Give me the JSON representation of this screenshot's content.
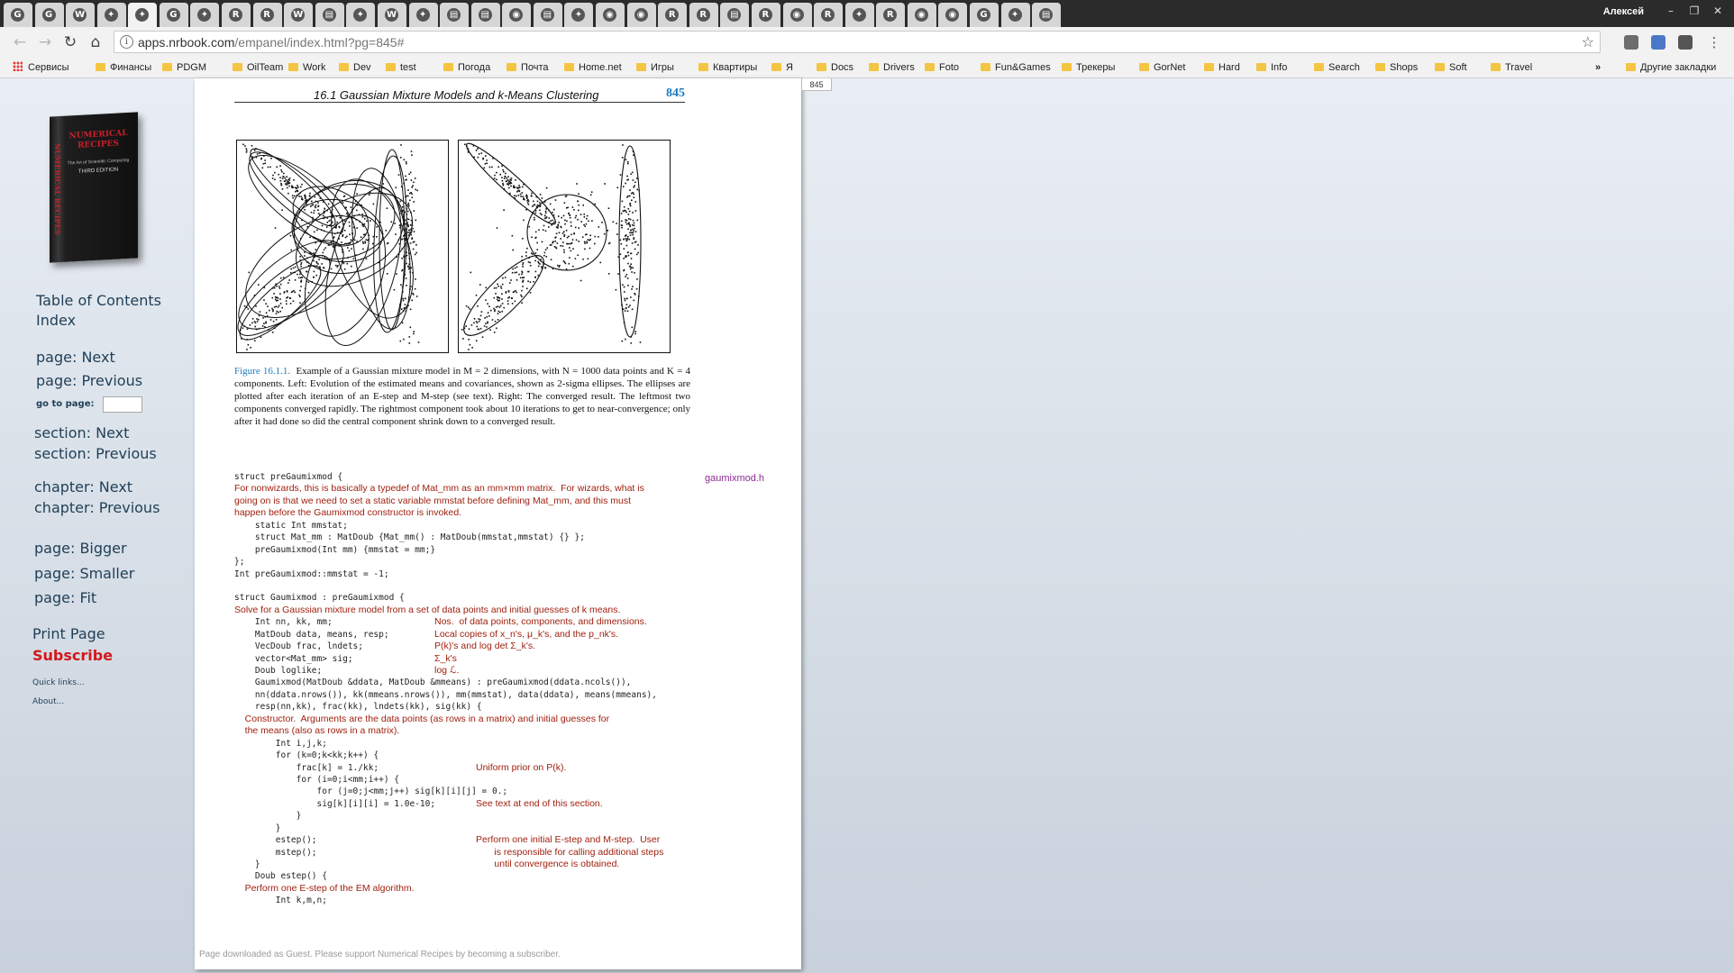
{
  "browser": {
    "profile_name": "Алексей",
    "url_host": "apps.nrbook.com",
    "url_path": "/empanel/index.html?pg=845#",
    "tabs_count": 34,
    "bookmarks": {
      "apps_label": "Сервисы",
      "folders": [
        "Финансы",
        "PDGM",
        "OilTeam",
        "Work",
        "Dev",
        "test",
        "Погода",
        "Почта",
        "Home.net",
        "Игры",
        "Квартиры",
        "Я",
        "Docs",
        "Drivers",
        "Foto",
        "Fun&Games",
        "Трекеры",
        "GorNet",
        "Hard",
        "Info",
        "Search",
        "Shops",
        "Soft",
        "Travel"
      ],
      "overflow": "»",
      "other": "Другие закладки"
    }
  },
  "sidebar": {
    "toc": "Table of Contents",
    "index": "Index",
    "page_next": "page: Next",
    "page_previous": "page: Previous",
    "goto_label": "go to page:",
    "section_next": "section: Next",
    "section_previous": "section: Previous",
    "chapter_next": "chapter: Next",
    "chapter_previous": "chapter: Previous",
    "page_bigger": "page: Bigger",
    "page_smaller": "page: Smaller",
    "page_fit": "page: Fit",
    "print_page": "Print Page",
    "subscribe": "Subscribe",
    "quick_links": "Quick links...",
    "about": "About...",
    "book_cover": {
      "title": "NUMERICAL RECIPES",
      "subtitle": "The Art of Scientific Computing",
      "edition": "THIRD EDITION"
    }
  },
  "page": {
    "page_tab": "845",
    "section_title": "16.1 Gaussian Mixture Models and k-Means Clustering",
    "page_number": "845",
    "caption_label": "Figure 16.1.1.",
    "caption_text": "Example of a Gaussian mixture model in M = 2 dimensions, with N = 1000 data points and K = 4 components. Left: Evolution of the estimated means and covariances, shown as 2-sigma ellipses. The ellipses are plotted after each iteration of an E-step and M-step (see text). Right: The converged result. The leftmost two components converged rapidly. The rightmost component took about 10 iterations to get to near-convergence; only after it had done so did the central component shrink down to a converged result.",
    "filename": "gaumixmod.h",
    "code_lines": [
      {
        "t": "code",
        "s": "struct preGaumixmod {"
      },
      {
        "t": "cm",
        "s": "For nonwizards, this is basically a typedef of Mat_mm as an mm×mm matrix.  For wizards, what is"
      },
      {
        "t": "cm",
        "s": "going on is that we need to set a static variable mmstat before defining Mat_mm, and this must"
      },
      {
        "t": "cm",
        "s": "happen before the Gaumixmod constructor is invoked."
      },
      {
        "t": "code",
        "s": "    static Int mmstat;"
      },
      {
        "t": "code",
        "s": "    struct Mat_mm : MatDoub {Mat_mm() : MatDoub(mmstat,mmstat) {} };"
      },
      {
        "t": "code",
        "s": "    preGaumixmod(Int mm) {mmstat = mm;}"
      },
      {
        "t": "code",
        "s": "};"
      },
      {
        "t": "code",
        "s": "Int preGaumixmod::mmstat = -1;"
      },
      {
        "t": "code",
        "s": ""
      },
      {
        "t": "code",
        "s": "struct Gaumixmod : preGaumixmod {"
      },
      {
        "t": "cm",
        "s": "Solve for a Gaussian mixture model from a set of data points and initial guesses of k means."
      },
      {
        "t": "code",
        "s": "    Int nn, kk, mm;",
        "n": "Nos.  of data points, components, and dimensions."
      },
      {
        "t": "code",
        "s": "    MatDoub data, means, resp;",
        "n": "Local copies of x_n's, μ_k's, and the p_nk's."
      },
      {
        "t": "code",
        "s": "    VecDoub frac, lndets;",
        "n": "P(k)'s and log det Σ_k's."
      },
      {
        "t": "code",
        "s": "    vector<Mat_mm> sig;",
        "n": "Σ_k's"
      },
      {
        "t": "code",
        "s": "    Doub loglike;",
        "n": "log ℒ."
      },
      {
        "t": "code",
        "s": "    Gaumixmod(MatDoub &ddata, MatDoub &mmeans) : preGaumixmod(ddata.ncols()),"
      },
      {
        "t": "code",
        "s": "    nn(ddata.nrows()), kk(mmeans.nrows()), mm(mmstat), data(ddata), means(mmeans),"
      },
      {
        "t": "code",
        "s": "    resp(nn,kk), frac(kk), lndets(kk), sig(kk) {"
      },
      {
        "t": "cm",
        "s": "    Constructor.  Arguments are the data points (as rows in a matrix) and initial guesses for"
      },
      {
        "t": "cm",
        "s": "    the means (also as rows in a matrix)."
      },
      {
        "t": "code",
        "s": "        Int i,j,k;"
      },
      {
        "t": "code",
        "s": "        for (k=0;k<kk;k++) {"
      },
      {
        "t": "code",
        "s": "            frac[k] = 1./kk;",
        "n2": "Uniform prior on P(k)."
      },
      {
        "t": "code",
        "s": "            for (i=0;i<mm;i++) {"
      },
      {
        "t": "code",
        "s": "                for (j=0;j<mm;j++) sig[k][i][j] = 0.;"
      },
      {
        "t": "code",
        "s": "                sig[k][i][i] = 1.0e-10;",
        "n2": "See text at end of this section."
      },
      {
        "t": "code",
        "s": "            }"
      },
      {
        "t": "code",
        "s": "        }"
      },
      {
        "t": "code",
        "s": "        estep();",
        "n2": "Perform one initial E-step and M-step.  User"
      },
      {
        "t": "code",
        "s": "        mstep();",
        "n2": "       is responsible for calling additional steps"
      },
      {
        "t": "code",
        "s": "    }",
        "n2": "       until convergence is obtained."
      },
      {
        "t": "code",
        "s": "    Doub estep() {"
      },
      {
        "t": "cm",
        "s": "    Perform one E-step of the EM algorithm."
      },
      {
        "t": "code",
        "s": "        Int k,m,n;"
      }
    ],
    "footer": "Page downloaded as Guest.  Please support Numerical Recipes by becoming a subscriber."
  },
  "colors": {
    "accent_blue": "#1a7ac0",
    "comment_red": "#a0210f",
    "subscribe_red": "#d0191c",
    "filename_purple": "#8b2b94"
  }
}
